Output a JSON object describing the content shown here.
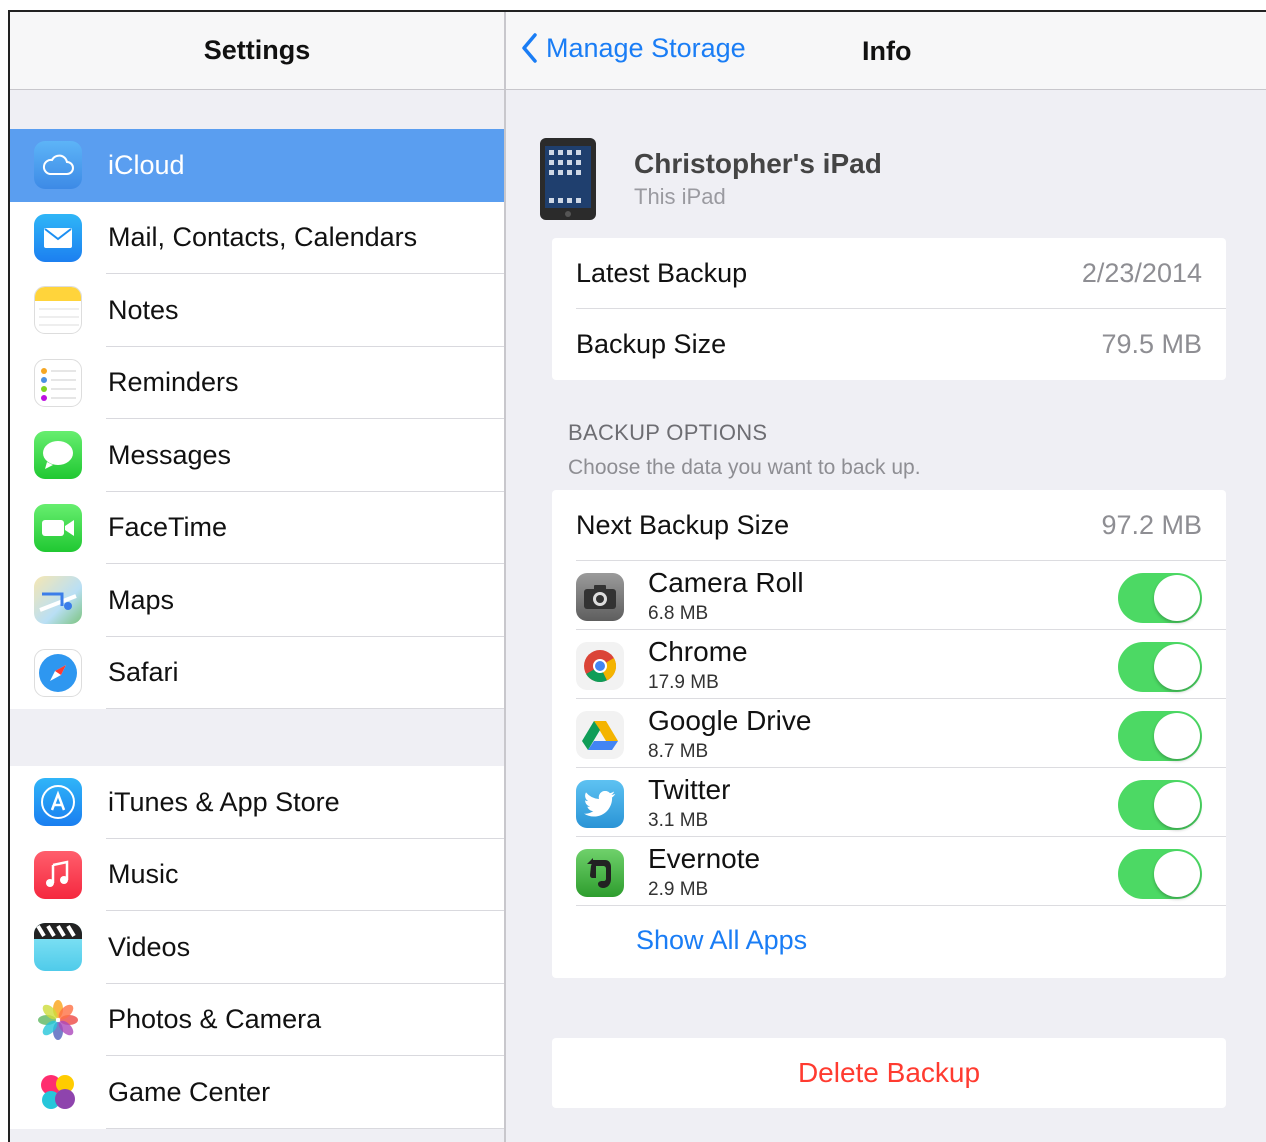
{
  "colors": {
    "accent": "#1a7df5",
    "selected_row": "#5a9ef0",
    "toggle_on": "#4cd964",
    "destructive": "#ff3b30"
  },
  "left_pane": {
    "title": "Settings",
    "group1": [
      {
        "label": "iCloud",
        "icon": "icloud-icon",
        "selected": true
      },
      {
        "label": "Mail, Contacts, Calendars",
        "icon": "mail-icon"
      },
      {
        "label": "Notes",
        "icon": "notes-icon"
      },
      {
        "label": "Reminders",
        "icon": "reminders-icon"
      },
      {
        "label": "Messages",
        "icon": "messages-icon"
      },
      {
        "label": "FaceTime",
        "icon": "facetime-icon"
      },
      {
        "label": "Maps",
        "icon": "maps-icon"
      },
      {
        "label": "Safari",
        "icon": "safari-icon"
      }
    ],
    "group2": [
      {
        "label": "iTunes & App Store",
        "icon": "app-store-icon"
      },
      {
        "label": "Music",
        "icon": "music-icon"
      },
      {
        "label": "Videos",
        "icon": "videos-icon"
      },
      {
        "label": "Photos & Camera",
        "icon": "photos-icon"
      },
      {
        "label": "Game Center",
        "icon": "game-center-icon"
      }
    ]
  },
  "right_pane": {
    "back_label": "Manage Storage",
    "title": "Info",
    "device": {
      "name": "Christopher's iPad",
      "subtitle": "This iPad"
    },
    "backup_info": [
      {
        "key": "Latest Backup",
        "value": "2/23/2014"
      },
      {
        "key": "Backup Size",
        "value": "79.5 MB"
      }
    ],
    "options_title": "BACKUP OPTIONS",
    "options_subtitle": "Choose the data you want to back up.",
    "next_backup": {
      "key": "Next Backup Size",
      "value": "97.2 MB"
    },
    "apps": [
      {
        "name": "Camera Roll",
        "size": "6.8 MB",
        "icon": "camera-icon",
        "enabled": true
      },
      {
        "name": "Chrome",
        "size": "17.9 MB",
        "icon": "chrome-icon",
        "enabled": true
      },
      {
        "name": "Google Drive",
        "size": "8.7 MB",
        "icon": "google-drive-icon",
        "enabled": true
      },
      {
        "name": "Twitter",
        "size": "3.1 MB",
        "icon": "twitter-icon",
        "enabled": true
      },
      {
        "name": "Evernote",
        "size": "2.9 MB",
        "icon": "evernote-icon",
        "enabled": true
      }
    ],
    "show_all": "Show All Apps",
    "delete_label": "Delete Backup"
  }
}
